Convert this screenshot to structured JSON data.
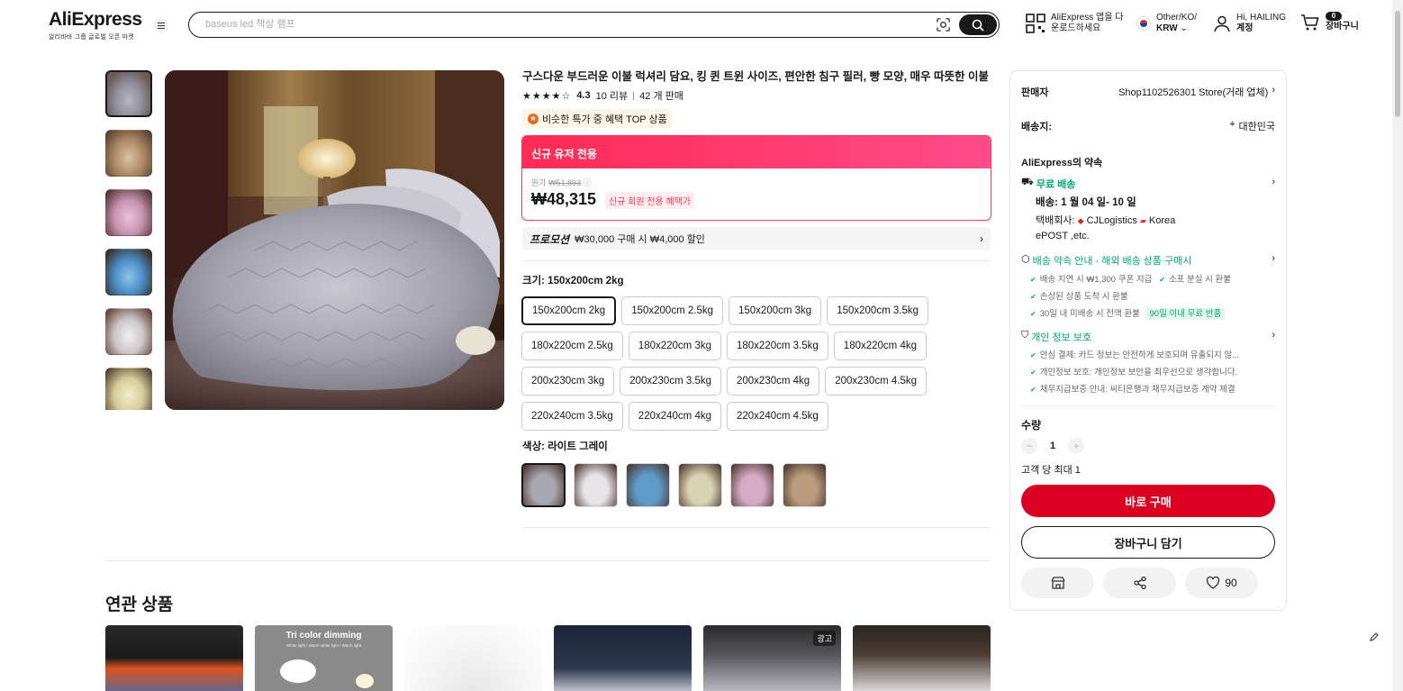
{
  "header": {
    "logo_text": "AliExpress",
    "logo_sub": "알리바바 그룹 글로벌 오픈 마켓",
    "search_placeholder": "baseus led 책상 램프",
    "app_line1": "AliExpress 앱을 다",
    "app_line2": "운로드하세요",
    "locale_line1": "Other/KO/",
    "locale_line2": "KRW",
    "account_line1": "Hi, HAILING",
    "account_line2": "계정",
    "cart_count": "0",
    "cart_label": "장바구니"
  },
  "product": {
    "title": "구스다운 부드러운 이불 럭셔리 담요, 킹 퀸 트윈 사이즈, 편안한 침구 필러, 빵 모양, 매우 따뜻한 이불",
    "stars": "★★★★☆",
    "rating": "4.3",
    "reviews": "10 리뷰",
    "sold": "42 개 판매",
    "top_badge": "비슷한 특가 중 혜택 TOP 상품",
    "promo_header": "신규 유저 전용",
    "original_label": "원가",
    "original_price": "₩51,893",
    "price": "₩48,315",
    "price_tag": "신규 회원 전용 혜택가",
    "promotion_label": "프로모션",
    "promotion_text": "₩30,000 구매 시 ₩4,000 할인",
    "size_label": "크기: 150x200cm 2kg",
    "sizes": [
      "150x200cm 2kg",
      "150x200cm 2.5kg",
      "150x200cm 3kg",
      "150x200cm 3.5kg",
      "180x220cm 2.5kg",
      "180x220cm 3kg",
      "180x220cm 3.5kg",
      "180x220cm 4kg",
      "200x230cm 3kg",
      "200x230cm 3.5kg",
      "200x230cm 4kg",
      "200x230cm 4.5kg",
      "220x240cm 3.5kg",
      "220x240cm 4kg",
      "220x240cm 4.5kg"
    ],
    "color_label": "색상: 라이트 그레이",
    "colors": [
      "#a9a8b2",
      "#e6e4e6",
      "#5f9bc9",
      "#d9d2b0",
      "#d6a9c4",
      "#b99c7e"
    ]
  },
  "related": {
    "title": "연관 상품",
    "card2_text": "Tri color dimming",
    "card2_sub": "White light / Warm white light / Warm light",
    "ad_tag": "광고"
  },
  "panel": {
    "seller_label": "판매자",
    "seller_name": "Shop1102526301 Store(거래 업체)",
    "ship_label": "배송지:",
    "ship_to": "대한민국",
    "promise_title": "AliExpress의 약속",
    "free_shipping": "무료 배송",
    "delivery": "배송: 1 월 04 일- 10 일",
    "carrier_label": "택배회사:",
    "carrier1": "CJLogistics",
    "carrier2": "Korea",
    "carrier3": "ePOST ,etc.",
    "guarantee_title": "배송 약속 안내 - 해외 배송 상품 구매시",
    "g1": "배송 지연 시 ₩1,300 쿠폰 지급",
    "g2": "소포 분실 시 환불",
    "g3": "손상된 상품 도착 시 환불",
    "g4": "30일 내 미배송 시 전액 환불",
    "g4_tag": "90일 이내 무료 반품",
    "privacy_title": "개인 정보 보호",
    "p1": "안심 결제: 카드 정보는 안전하게 보호되며 유출되지 않...",
    "p2": "개인정보 보호: 개인정보 보안을 최우선으로 생각합니다.",
    "p3": "채무지급보증 안내: 씨티은행과 채무지급보증 계약 체결",
    "qty_label": "수량",
    "qty_value": "1",
    "qty_limit": "고객 당 최대 1",
    "buy_now": "바로 구매",
    "add_to_cart": "장바구니 담기",
    "wishlist_count": "90"
  }
}
